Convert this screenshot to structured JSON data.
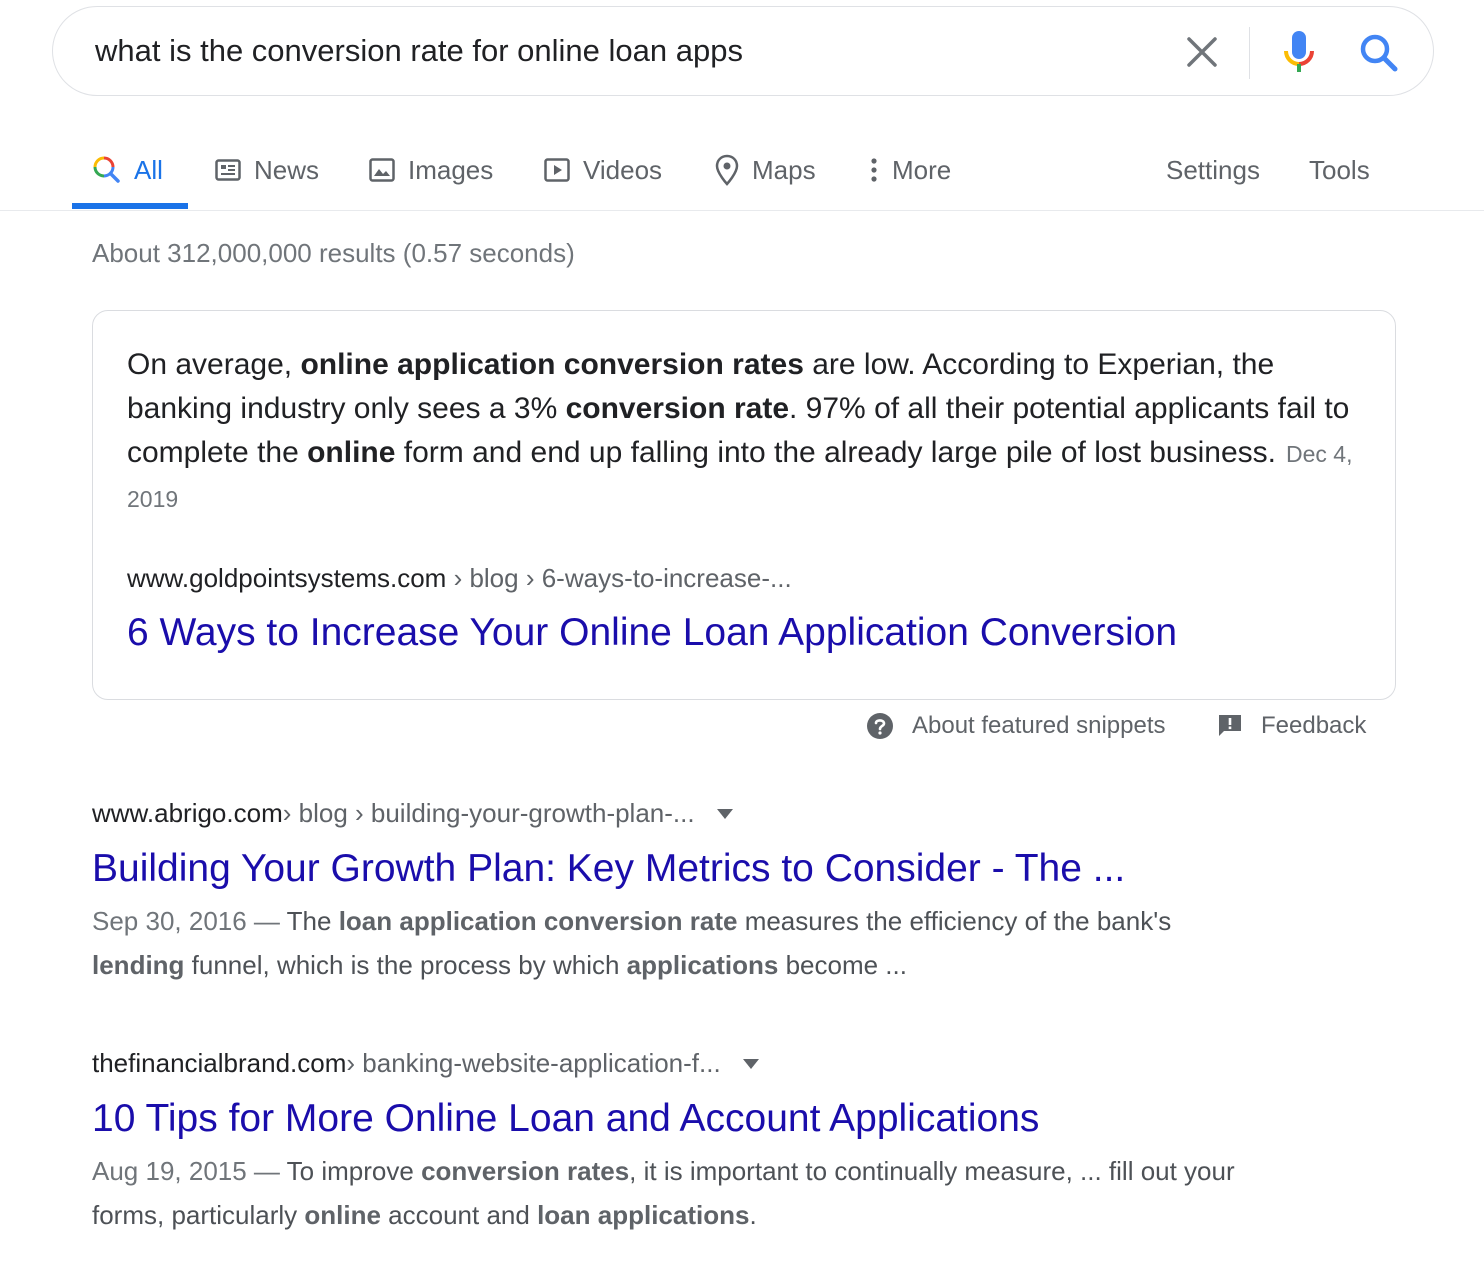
{
  "search": {
    "query": "what is the conversion rate for online loan apps"
  },
  "tabs": [
    {
      "label": "All",
      "icon": "search-icon",
      "active": true
    },
    {
      "label": "News",
      "icon": "news-icon"
    },
    {
      "label": "Images",
      "icon": "image-icon"
    },
    {
      "label": "Videos",
      "icon": "video-icon"
    },
    {
      "label": "Maps",
      "icon": "map-pin-icon"
    },
    {
      "label": "More",
      "icon": "more-vert-icon"
    }
  ],
  "tools": {
    "settings": "Settings",
    "tools": "Tools"
  },
  "stats": "About 312,000,000 results (0.57 seconds)",
  "featured_snippet": {
    "t1": "On average, ",
    "b1": "online application conversion rates",
    "t2": " are low. According to Experian, the banking industry only sees a 3% ",
    "b2": "conversion rate",
    "t3": ". 97% of all their potential applicants fail to complete the ",
    "b3": "online",
    "t4": " form and end up falling into the already large pile of lost business.",
    "date": "Dec 4, 2019",
    "url_host": "www.goldpointsystems.com",
    "url_path": " › blog › 6-ways-to-increase-...",
    "title": "6 Ways to Increase Your Online Loan Application Conversion"
  },
  "snippet_footer": {
    "about": "About featured snippets",
    "feedback": "Feedback"
  },
  "results": [
    {
      "url_host": "www.abrigo.com",
      "url_path": " › blog › building-your-growth-plan-...",
      "title": "Building Your Growth Plan: Key Metrics to Consider - The ...",
      "date": "Sep 30, 2016 — ",
      "d1": "The ",
      "b1": "loan application conversion rate",
      "d2": " measures the efficiency of the bank's ",
      "b2": "lending",
      "d3": " funnel, which is the process by which ",
      "b3": "applications",
      "d4": " become ..."
    },
    {
      "url_host": "thefinancialbrand.com",
      "url_path": " › banking-website-application-f...",
      "title": "10 Tips for More Online Loan and Account Applications",
      "date": "Aug 19, 2015 — ",
      "d1": "To improve ",
      "b1": "conversion rates",
      "d2": ", it is important to continually measure, ... fill out your forms, particularly ",
      "b2": "online",
      "d3": " account and ",
      "b3": "loan applications",
      "d4": "."
    }
  ],
  "colors": {
    "link": "#1a0dab",
    "accent": "#1a73e8",
    "muted": "#70757a"
  }
}
